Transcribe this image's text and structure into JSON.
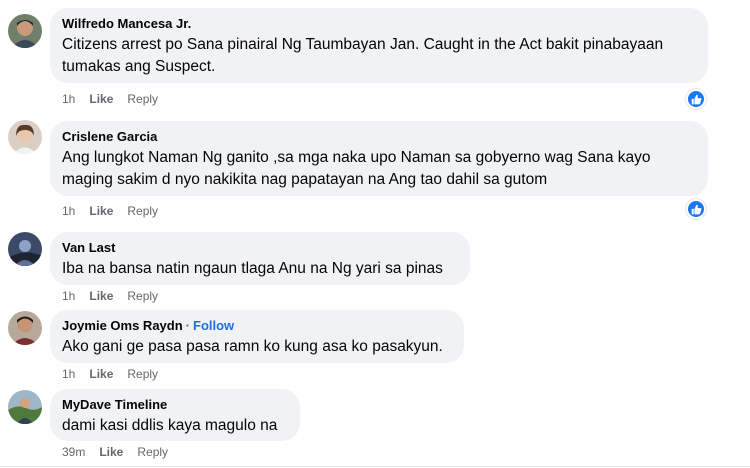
{
  "comments": [
    {
      "author": "Wilfredo Mancesa Jr.",
      "text_lines": [
        "Citizens arrest po Sana pinairal Ng Taumbayan Jan. Caught in the Act bakit pinabayaan",
        "tumakas ang Suspect."
      ],
      "time": "1h",
      "like": "Like",
      "reply": "Reply",
      "reaction_icon": "like-icon"
    },
    {
      "author": "Crislene Garcia",
      "text_lines": [
        "Ang lungkot Naman Ng ganito ,sa mga naka upo Naman sa gobyerno wag Sana kayo",
        "maging sakim d nyo nakikita nag papatayan na Ang tao dahil sa gutom"
      ],
      "time": "1h",
      "like": "Like",
      "reply": "Reply",
      "reaction_icon": "like-icon"
    },
    {
      "author": "Van Last",
      "text_lines": [
        "Iba na bansa natin ngaun tlaga Anu na Ng yari sa pinas"
      ],
      "time": "1h",
      "like": "Like",
      "reply": "Reply"
    },
    {
      "author": "Joymie Oms Raydn",
      "follow": "Follow",
      "text_lines": [
        "Ako gani ge pasa pasa ramn ko kung asa ko pasakyun."
      ],
      "time": "1h",
      "like": "Like",
      "reply": "Reply"
    },
    {
      "author": "MyDave Timeline",
      "text_lines": [
        "dami kasi ddlis kaya magulo na"
      ],
      "time": "39m",
      "like": "Like",
      "reply": "Reply"
    }
  ],
  "colors": {
    "bubble": "#f0f2f5",
    "like_blue": "#1877f2",
    "follow_blue": "#216fdb",
    "meta_gray": "#65676b"
  }
}
